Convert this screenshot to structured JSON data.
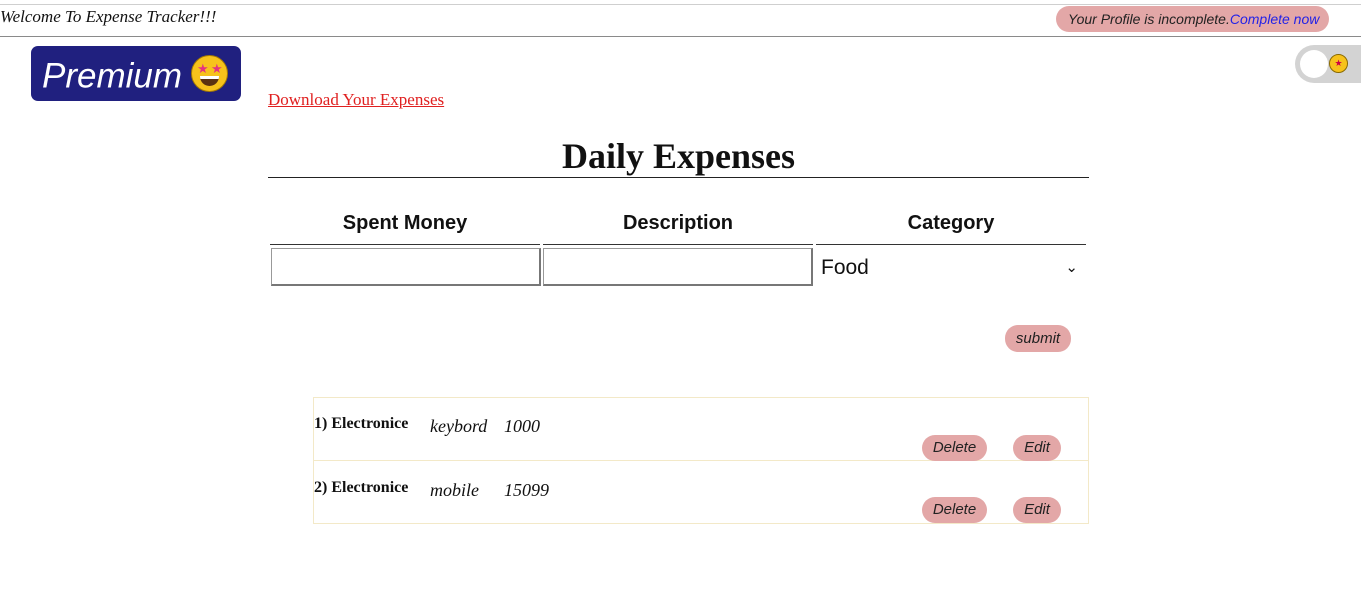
{
  "header": {
    "welcome": "Welcome To Expense Tracker!!!",
    "profile_text": "Your Profile is incomplete.",
    "profile_link": "Complete now"
  },
  "premium": {
    "label": "Premium",
    "emoji": "star-struck-emoji"
  },
  "theme_toggle": {
    "icon": "sun-icon",
    "state": "off"
  },
  "download_link": "Download Your Expenses",
  "form": {
    "title": "Daily Expenses",
    "columns": [
      "Spent Money",
      "Description",
      "Category"
    ],
    "spent_value": "",
    "description_value": "",
    "category_selected": "Food",
    "submit_label": "submit"
  },
  "expenses": [
    {
      "index": "1)",
      "category": "Electronice",
      "description": "keybord",
      "amount": "1000"
    },
    {
      "index": "2)",
      "category": "Electronice",
      "description": "mobile",
      "amount": "15099"
    }
  ],
  "actions": {
    "delete_label": "Delete",
    "edit_label": "Edit"
  },
  "colors": {
    "premium_bg": "#20207f",
    "pill_bg": "#e3a7a7",
    "link_red": "#e02020",
    "link_blue": "#2323e6"
  }
}
